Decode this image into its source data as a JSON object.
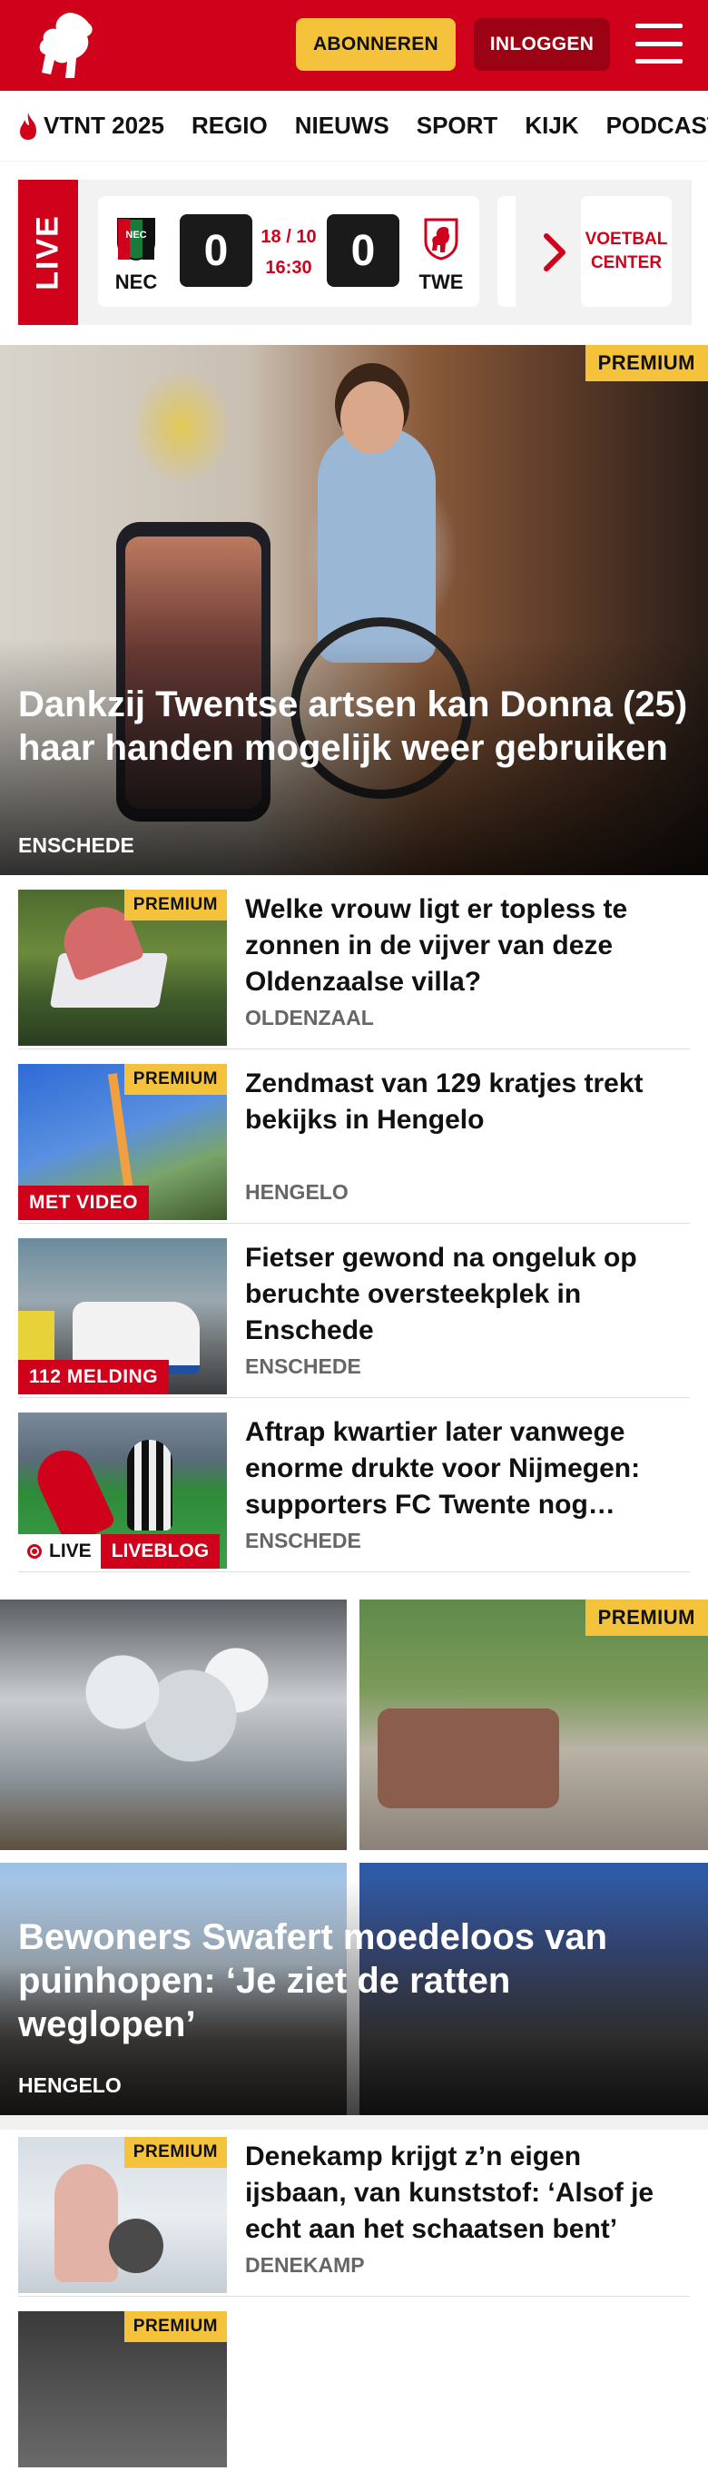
{
  "header": {
    "subscribe_label": "ABONNEREN",
    "login_label": "INLOGGEN"
  },
  "nav": {
    "items": [
      "VTNT 2025",
      "REGIO",
      "NIEUWS",
      "SPORT",
      "KIJK",
      "PODCAST"
    ]
  },
  "live": {
    "label": "LIVE",
    "home_team": "NEC",
    "away_team": "TWE",
    "home_score": "0",
    "away_score": "0",
    "date": "18 / 10",
    "time": "16:30",
    "voetbal_center": "VOETBAL CENTER"
  },
  "hero": {
    "premium": "PREMIUM",
    "title": "Dankzij Twentse artsen kan Donna (25) haar handen mogelijk weer gebruiken",
    "location": "ENSCHEDE"
  },
  "articles": [
    {
      "premium": "PREMIUM",
      "title": "Welke vrouw ligt er topless te zonnen in de vijver van deze Oldenzaalse villa?",
      "location": "OLDENZAAL"
    },
    {
      "premium": "PREMIUM",
      "title": "Zendmast van 129 kratjes trekt bekijks in Hengelo",
      "location": "HENGELO",
      "tag": "MET VIDEO"
    },
    {
      "title": "Fietser gewond na ongeluk op beruchte oversteekplek in Enschede",
      "location": "ENSCHEDE",
      "tag": "112 MELDING"
    },
    {
      "title": "Aftrap kwartier later vanwege enorme drukte voor Nijmegen: supporters FC Twente nog…",
      "location": "ENSCHEDE",
      "live": "LIVE",
      "liveblog": "LIVEBLOG"
    }
  ],
  "feature": {
    "premium": "PREMIUM",
    "title": "Bewoners Swafert moedeloos van puinhopen: ‘Je ziet de ratten weglopen’",
    "location": "HENGELO"
  },
  "articles2": [
    {
      "premium": "PREMIUM",
      "title": "Denekamp krijgt z’n eigen ijsbaan, van kunststof: ‘Alsof je echt aan het schaatsen bent’",
      "location": "DENEKAMP"
    },
    {
      "premium": "PREMIUM"
    }
  ],
  "colors": {
    "brand_red": "#d0021b",
    "premium_yellow": "#f5c33b"
  }
}
